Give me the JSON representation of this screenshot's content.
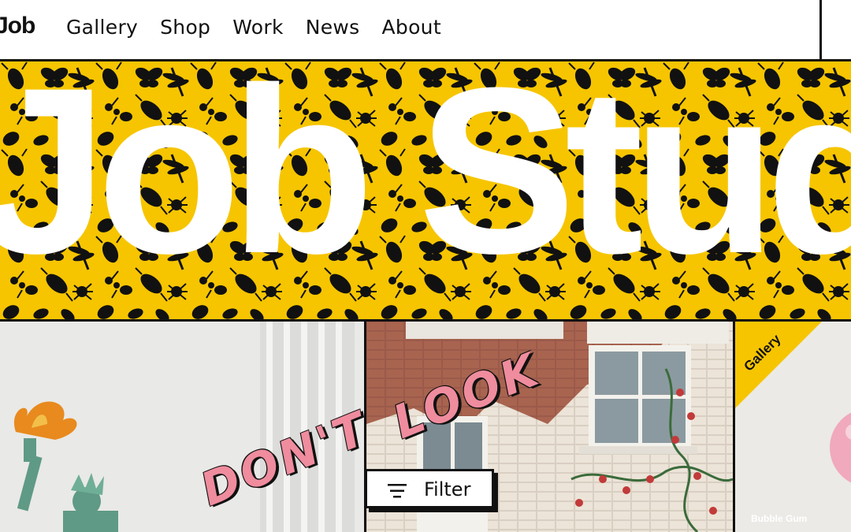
{
  "nav": {
    "logo": "Job",
    "items": [
      "Gallery",
      "Shop",
      "Work",
      "News",
      "About"
    ]
  },
  "hero": {
    "title": "Job Studio",
    "background_color": "#f6c500",
    "pattern": "black insect silhouettes"
  },
  "cards": [
    {
      "image": "statue-of-liberty-figure",
      "overlay_text": "DON'T"
    },
    {
      "image": "brick-building-with-roses",
      "overlay_text": "LOOK"
    },
    {
      "badge": "Gallery",
      "caption": "Bubble Gum",
      "image": "pink-bubble"
    }
  ],
  "filter": {
    "label": "Filter",
    "icon": "filter-lines-icon"
  },
  "colors": {
    "accent": "#f6c500",
    "pink": "#ef8c9e",
    "ink": "#111111"
  }
}
